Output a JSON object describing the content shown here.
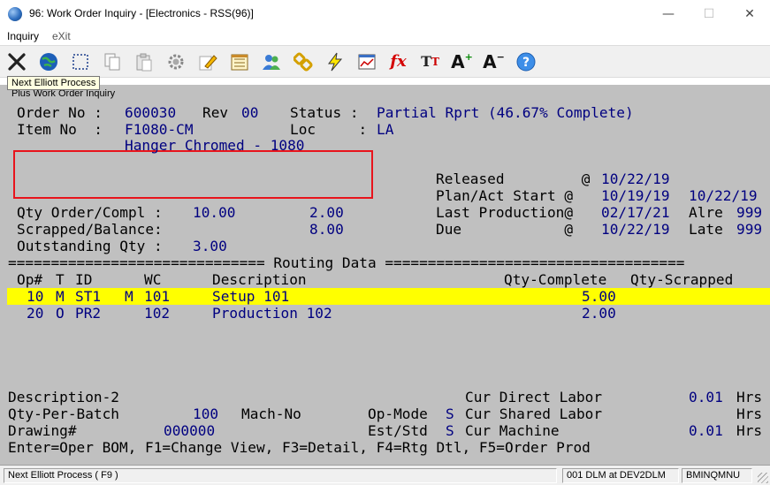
{
  "window": {
    "title": "96: Work Order Inquiry - [Electronics - RSS(96)]",
    "minimize": "—",
    "maximize": "☐",
    "close": "✕"
  },
  "menu": {
    "inquiry": "Inquiry",
    "exit": "eXit"
  },
  "toolbar_icons": [
    "close-x-icon",
    "globe-icon",
    "select-rect-icon",
    "copy-icon",
    "paste-icon",
    "gear-icon",
    "edit-pencil-icon",
    "notes-icon",
    "users-icon",
    "chain-link-icon",
    "lightning-icon",
    "chart-window-icon",
    "function-fx-icon",
    "text-size-icon",
    "font-increase-icon",
    "font-decrease-icon",
    "help-icon"
  ],
  "tooltip": "Next Elliott Process",
  "subtitle": "Plus Work Order Inquiry",
  "header": {
    "order_no_label": "Order No :",
    "order_no": "600030",
    "rev_label": "Rev",
    "rev": "00",
    "status_label": "Status :",
    "status": "Partial Rprt (46.67% Complete)",
    "item_no_label": "Item No  :",
    "item_no": "F1080-CM",
    "loc_label": "Loc     :",
    "loc": "LA",
    "item_desc": "Hanger Chromed - 1080"
  },
  "dates": {
    "released_label": "Released         @",
    "released": "10/22/19",
    "plan_label": "Plan/Act Start @",
    "plan_start": "10/19/19",
    "act_start": "10/22/19",
    "last_prod_label": "Last Production@",
    "last_prod": "02/17/21",
    "alre_label": "Alre",
    "alre": "999",
    "due_label": "Due            @",
    "due": "10/22/19",
    "late_label": "Late",
    "late": "999"
  },
  "qty": {
    "order_compl_label": "Qty Order/Compl :",
    "ordered": "10.00",
    "completed": "2.00",
    "scrapped_label": "Scrapped/Balance:",
    "balance": "8.00",
    "outstanding_label": "Outstanding Qty :",
    "outstanding": "3.00"
  },
  "routing": {
    "divider": "============================== Routing Data ===================================",
    "columns": {
      "op": "Op#",
      "t": "T",
      "id": "ID",
      "wc": "WC",
      "desc": "Description",
      "qty_complete": "Qty-Complete",
      "qty_scrapped": "Qty-Scrapped"
    },
    "rows": [
      {
        "op": "10",
        "t": "M",
        "id": "ST1",
        "m": "M",
        "wc": "101",
        "desc": "Setup 101",
        "qty_complete": "5.00",
        "qty_scrapped": ""
      },
      {
        "op": "20",
        "t": "O",
        "id": "PR2",
        "m": "",
        "wc": "102",
        "desc": "Production 102",
        "qty_complete": "2.00",
        "qty_scrapped": ""
      }
    ]
  },
  "footer": {
    "desc2_label": "Description-2",
    "qty_per_batch_label": "Qty-Per-Batch",
    "qty_per_batch": "100",
    "mach_no_label": "Mach-No",
    "op_mode_label": "Op-Mode",
    "op_mode": "S",
    "cur_direct_label": "Cur Direct Labor",
    "cur_direct": "0.01",
    "hrs": "Hrs",
    "drawing_label": "Drawing#",
    "drawing": "000000",
    "est_std_label": "Est/Std",
    "est_std": "S",
    "cur_shared_label": "Cur Shared Labor",
    "cur_machine_label": "Cur Machine",
    "cur_machine": "0.01",
    "keys": "Enter=Oper BOM, F1=Change View, F3=Detail, F4=Rtg Dtl, F5=Order Prod"
  },
  "statusbar": {
    "main": "Next Elliott Process ( F9 )",
    "session": "001 DLM at DEV2DLM",
    "program": "BMINQMNU"
  },
  "colors": {
    "highlight": "#ffff00",
    "value_text": "#000080",
    "terminal_bg": "#c0c0c0",
    "annotation": "#e8141c"
  }
}
